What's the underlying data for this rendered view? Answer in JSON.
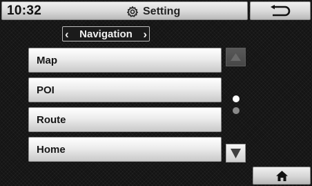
{
  "status_bar": {
    "time": "10:32",
    "title": "Setting",
    "title_icon": "gear-icon",
    "back_icon": "return-arrow-icon"
  },
  "breadcrumb": {
    "label": "Navigation",
    "prev_icon": "chevron-left-icon",
    "next_icon": "chevron-right-icon"
  },
  "menu": {
    "items": [
      {
        "label": "Map"
      },
      {
        "label": "POI"
      },
      {
        "label": "Route"
      },
      {
        "label": "Home"
      }
    ]
  },
  "pager": {
    "total_pages": 2,
    "current_page": 1,
    "up_icon": "triangle-up-icon",
    "down_icon": "triangle-down-icon",
    "up_enabled": false,
    "down_enabled": true
  },
  "footer": {
    "home_icon": "home-icon"
  },
  "colors": {
    "background": "#141414",
    "button_light": "#f0f0f0",
    "button_text": "#161616",
    "breadcrumb_text": "#f2f2f2"
  }
}
